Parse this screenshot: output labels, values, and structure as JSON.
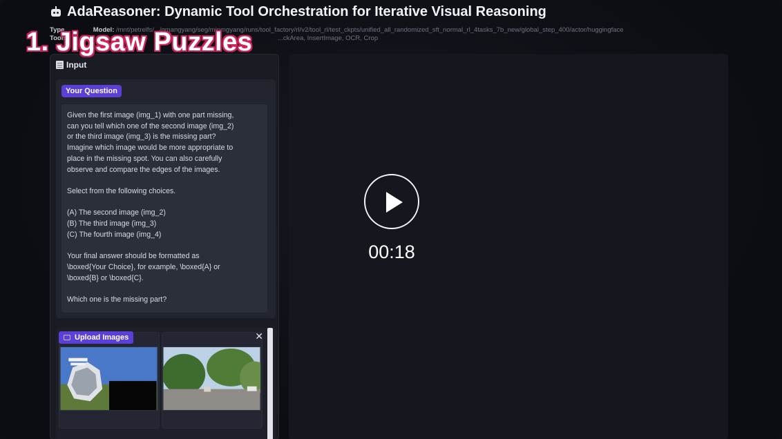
{
  "app": {
    "title": "AdaReasoner: Dynamic Tool Orchestration for Iterative Visual Reasoning"
  },
  "meta": {
    "type_label": "Type",
    "model_label": "Model:",
    "model_value": "/mnt/petrelfs/.../gmangyang/seg/minmgyang/runs/tool_factory/rl/v2/tool_rl/test_ckpts/unified_all_randomized_sft_normal_rl_4tasks_7b_new/global_step_400/actor/huggingface",
    "tools_label": "Tools",
    "tools_value": "...ckArea, InsertImage, OCR, Crop"
  },
  "overlay": {
    "caption": "1. Jigsaw Puzzles"
  },
  "input_panel": {
    "header": "Input",
    "question_badge": "Your Question",
    "question_text": "Given the first image (img_1) with one part missing,\ncan you tell which one of the second image (img_2)\nor the third image (img_3) is the missing part?\nImagine which image would be more appropriate to\nplace in the missing spot. You can also carefully\nobserve and compare the edges of the images.\n\nSelect from the following choices.\n\n(A) The second image (img_2)\n(B) The third image (img_3)\n(C) The fourth image (img_4)\n\nYour final answer should be formatted as\n\\boxed{Your Choice}, for example, \\boxed{A} or\n\\boxed{B} or \\boxed{C}.\n\nWhich one is the missing part?",
    "upload_badge": "Upload Images",
    "close_glyph": "✕"
  },
  "video": {
    "timestamp": "00:18"
  },
  "icons": {
    "title_icon": "robot-icon",
    "header_icon": "memo-icon",
    "upload_icon": "image-upload-icon",
    "play_icon": "play-icon",
    "close_icon": "close-icon"
  },
  "colors": {
    "accent": "#5b3fd6",
    "caption_outline": "#d0245c"
  }
}
